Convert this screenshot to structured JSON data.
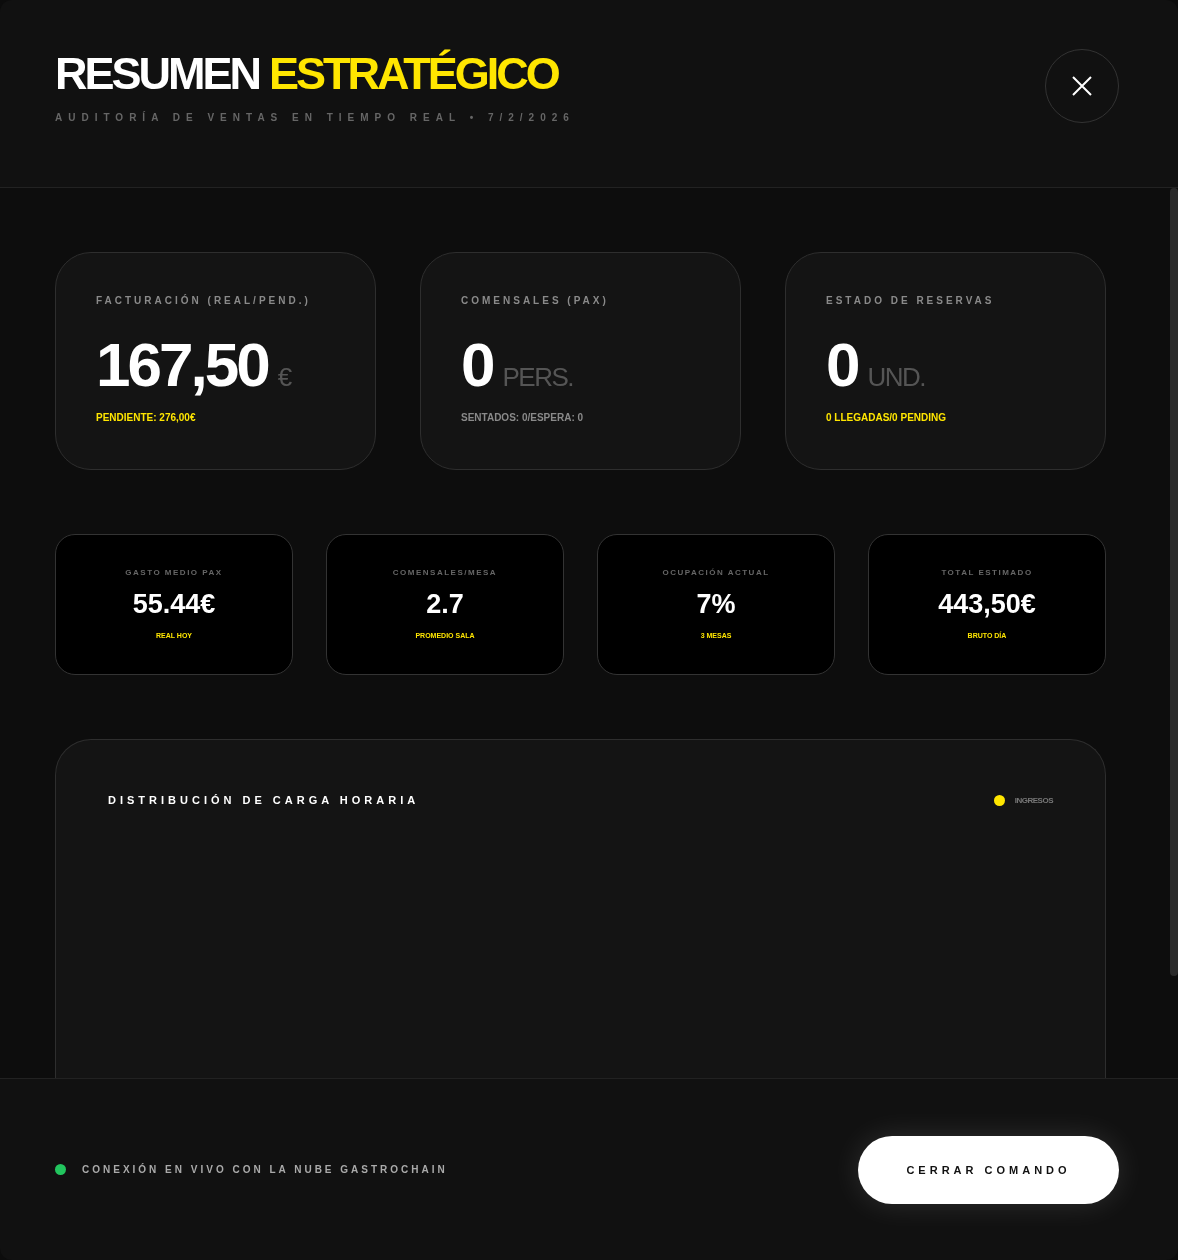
{
  "header": {
    "title_main": "RESUMEN",
    "title_accent": "ESTRATÉGICO",
    "subtitle": "AUDITORÍA DE VENTAS EN TIEMPO REAL • 7/2/2026"
  },
  "kpis": [
    {
      "label": "FACTURACIÓN (REAL/PEND.)",
      "value": "167,50",
      "unit": "€",
      "note": "PENDIENTE: 276,00€",
      "highlight": true
    },
    {
      "label": "COMENSALES (PAX)",
      "value": "0",
      "unit": "PERS.",
      "note": "SENTADOS: 0/ESPERA: 0",
      "highlight": false
    },
    {
      "label": "ESTADO DE RESERVAS",
      "value": "0",
      "unit": "UND.",
      "note": "0 LLEGADAS/0 PENDING",
      "highlight": true
    }
  ],
  "metrics": [
    {
      "label": "GASTO MEDIO PAX",
      "value": "55.44€",
      "note": "REAL HOY"
    },
    {
      "label": "COMENSALES/MESA",
      "value": "2.7",
      "note": "PROMEDIO SALA"
    },
    {
      "label": "OCUPACIÓN ACTUAL",
      "value": "7%",
      "note": "3 MESAS"
    },
    {
      "label": "TOTAL ESTIMADO",
      "value": "443,50€",
      "note": "BRUTO DÍA"
    }
  ],
  "chart": {
    "title": "DISTRIBUCIÓN DE CARGA HORARIA",
    "legend": [
      {
        "label": "INGRESOS",
        "color": "#ffe600"
      }
    ]
  },
  "footer": {
    "status": "CONEXIÓN EN VIVO CON LA NUBE GASTROCHAIN",
    "live": true,
    "button": "CERRAR COMANDO"
  }
}
